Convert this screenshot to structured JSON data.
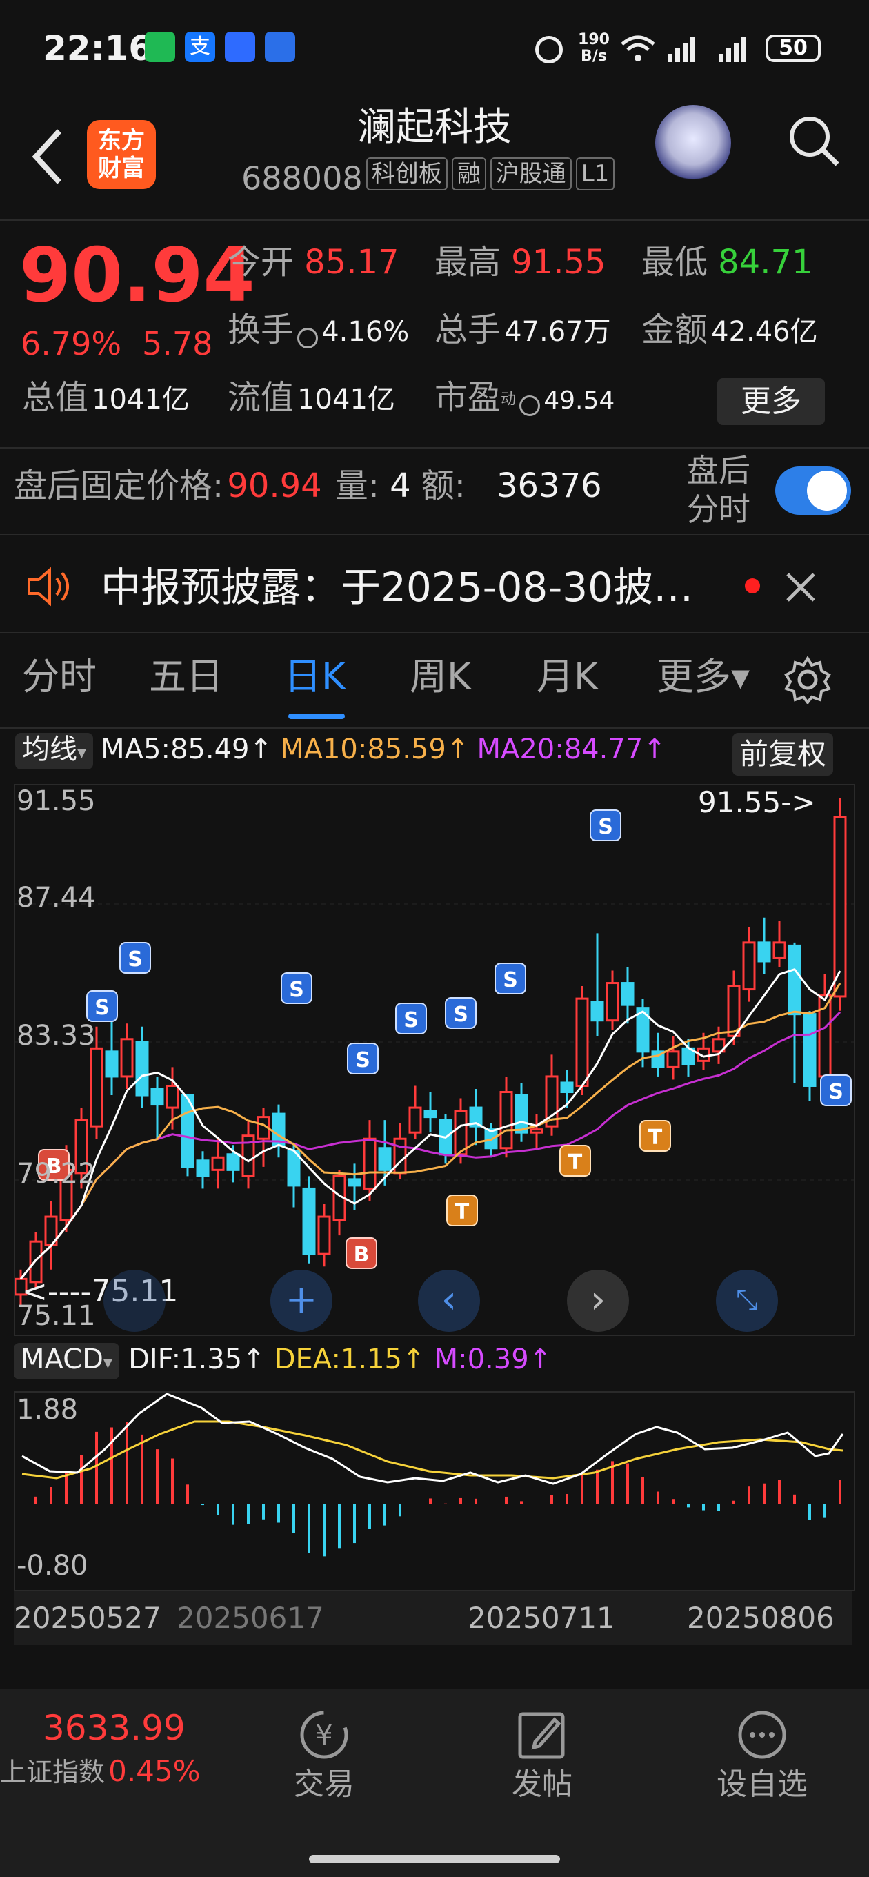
{
  "status_bar": {
    "time": "22:16",
    "speed_top": "190",
    "speed_bottom": "B/s",
    "battery": "50"
  },
  "header": {
    "logo_line1": "东方",
    "logo_line2": "财富",
    "title": "澜起科技",
    "code": "688008",
    "tags": [
      "科创板",
      "融",
      "沪股通",
      "L1"
    ]
  },
  "quote": {
    "price": "90.94",
    "change_pct": "6.79%",
    "change_amt": "5.78",
    "open_label": "今开",
    "open": "85.17",
    "high_label": "最高",
    "high": "91.55",
    "low_label": "最低",
    "low": "84.71",
    "turnover_label": "换手",
    "turnover": "4.16%",
    "volume_label": "总手",
    "volume": "47.67万",
    "amount_label": "金额",
    "amount": "42.46亿",
    "mktcap_label": "总值",
    "mktcap": "1041亿",
    "float_label": "流值",
    "float": "1041亿",
    "pe_label": "市盈",
    "pe_sup": "动",
    "pe": "49.54",
    "more_label": "更多"
  },
  "after_hours": {
    "label": "盘后固定价格:",
    "price": "90.94",
    "vol_label": "量:",
    "vol": "4",
    "amt_label": "额:",
    "amt": "36376",
    "toggle_line1": "盘后",
    "toggle_line2": "分时"
  },
  "notice": {
    "text": "中报预披露：于2025-08-30披…"
  },
  "tabs": [
    "分时",
    "五日",
    "日K",
    "周K",
    "月K",
    "更多▾"
  ],
  "ma_bar": {
    "dropdown": "均线",
    "ma5": "MA5:85.49↑",
    "ma10": "MA10:85.59↑",
    "ma20": "MA20:84.77↑",
    "adjust": "前复权"
  },
  "kline": {
    "y_labels": [
      "91.55",
      "87.44",
      "83.33",
      "79.22",
      "75.11"
    ],
    "high_marker": "91.55->",
    "low_marker": "<----75.11"
  },
  "macd": {
    "dropdown": "MACD",
    "dif": "DIF:1.35↑",
    "dea": "DEA:1.15↑",
    "m": "M:0.39↑",
    "y_top": "1.88",
    "y_bottom": "-0.80"
  },
  "dates": [
    "20250527",
    "20250617",
    "20250711",
    "20250806"
  ],
  "bottom_nav": {
    "index_value": "3633.99",
    "index_name": "上证指数",
    "index_change": "0.45%",
    "trade": "交易",
    "post": "发帖",
    "watch": "设自选"
  },
  "chart_data": {
    "type": "candlestick",
    "ylim": [
      75.11,
      91.55
    ],
    "candles": [
      [
        75.6,
        76.1,
        75.2,
        76.4
      ],
      [
        76.0,
        77.3,
        75.8,
        77.6
      ],
      [
        77.2,
        78.1,
        76.4,
        78.6
      ],
      [
        78.0,
        79.6,
        77.6,
        80.4
      ],
      [
        79.5,
        81.2,
        79.0,
        81.6
      ],
      [
        81.0,
        83.5,
        80.6,
        84.2
      ],
      [
        83.4,
        82.6,
        82.0,
        84.4
      ],
      [
        82.6,
        83.8,
        82.2,
        84.3
      ],
      [
        83.7,
        82.0,
        81.6,
        84.2
      ],
      [
        82.2,
        81.7,
        80.6,
        82.6
      ],
      [
        81.6,
        82.3,
        80.9,
        82.9
      ],
      [
        82.0,
        79.7,
        79.4,
        82.0
      ],
      [
        79.9,
        79.4,
        79.0,
        80.2
      ],
      [
        79.6,
        80.0,
        79.0,
        80.6
      ],
      [
        80.1,
        79.6,
        79.2,
        80.4
      ],
      [
        79.4,
        80.7,
        79.0,
        81.2
      ],
      [
        80.6,
        81.3,
        79.7,
        81.6
      ],
      [
        81.4,
        80.4,
        80.0,
        81.7
      ],
      [
        80.2,
        79.1,
        78.4,
        80.4
      ],
      [
        79.0,
        76.9,
        76.6,
        79.4
      ],
      [
        76.9,
        78.1,
        76.5,
        78.5
      ],
      [
        78.0,
        79.4,
        77.5,
        79.6
      ],
      [
        79.3,
        79.1,
        78.3,
        79.8
      ],
      [
        79.0,
        80.6,
        78.6,
        81.2
      ],
      [
        80.3,
        79.6,
        79.1,
        81.2
      ],
      [
        79.5,
        80.6,
        79.3,
        81.1
      ],
      [
        80.8,
        81.6,
        80.6,
        82.3
      ],
      [
        81.5,
        81.3,
        80.8,
        82.1
      ],
      [
        81.2,
        80.1,
        79.8,
        81.4
      ],
      [
        80.1,
        81.5,
        79.8,
        81.9
      ],
      [
        81.6,
        81.0,
        80.4,
        82.2
      ],
      [
        80.9,
        80.3,
        80.0,
        81.1
      ],
      [
        80.3,
        82.1,
        80.0,
        82.6
      ],
      [
        82.0,
        80.8,
        80.5,
        82.4
      ],
      [
        80.8,
        80.9,
        80.3,
        81.4
      ],
      [
        81.0,
        82.6,
        80.7,
        83.3
      ],
      [
        82.4,
        82.1,
        81.6,
        82.8
      ],
      [
        82.3,
        85.1,
        82.0,
        85.5
      ],
      [
        85.0,
        84.4,
        83.9,
        87.2
      ],
      [
        84.4,
        85.6,
        84.1,
        86.0
      ],
      [
        85.6,
        84.9,
        84.3,
        86.1
      ],
      [
        84.8,
        83.4,
        82.9,
        85.1
      ],
      [
        83.4,
        82.9,
        82.6,
        84.0
      ],
      [
        82.9,
        83.4,
        82.5,
        83.9
      ],
      [
        83.5,
        83.0,
        82.6,
        83.8
      ],
      [
        83.1,
        83.5,
        82.8,
        84.0
      ],
      [
        83.4,
        83.8,
        83.0,
        84.2
      ],
      [
        83.9,
        85.5,
        83.6,
        86.0
      ],
      [
        85.4,
        86.9,
        85.0,
        87.4
      ],
      [
        86.9,
        86.3,
        85.9,
        87.7
      ],
      [
        86.4,
        86.9,
        86.1,
        87.6
      ],
      [
        86.8,
        84.6,
        82.4,
        86.9
      ],
      [
        84.6,
        82.3,
        81.8,
        84.7
      ],
      [
        82.6,
        85.2,
        82.4,
        85.9
      ],
      [
        85.17,
        90.94,
        84.71,
        91.55
      ]
    ]
  }
}
